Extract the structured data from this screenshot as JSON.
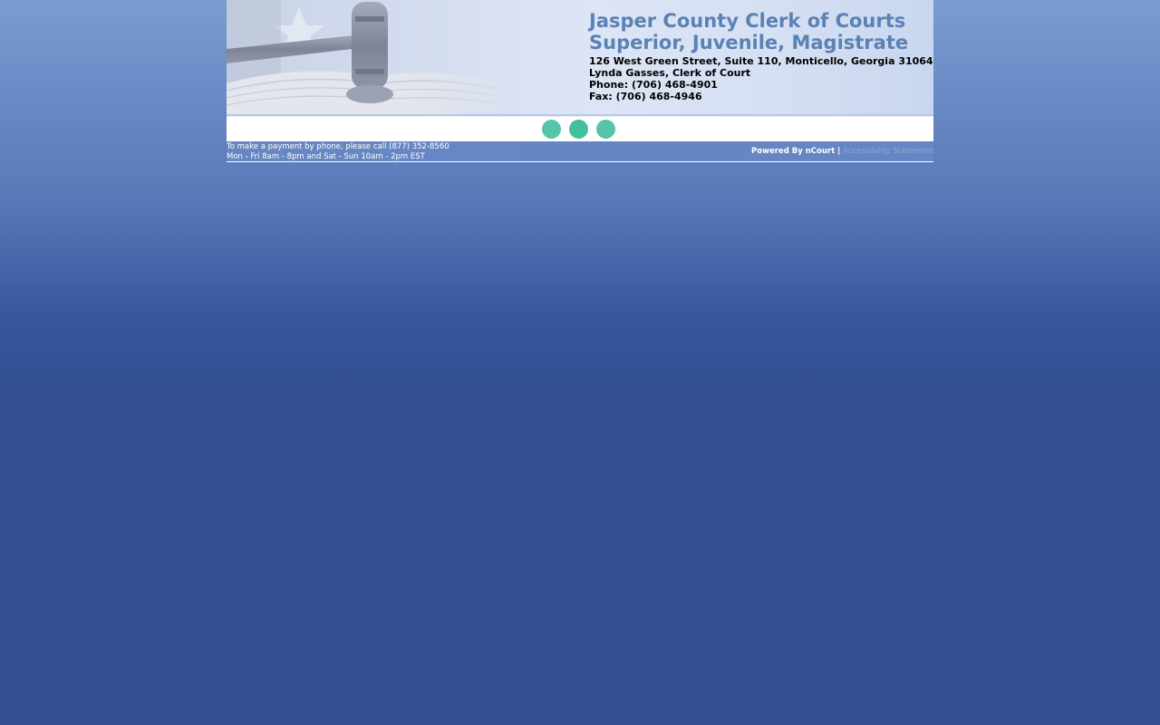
{
  "banner": {
    "title_line1": "Jasper County Clerk of Courts",
    "title_line2": "Superior, Juvenile, Magistrate",
    "address": "126 West Green Street, Suite 110, Monticello, Georgia 31064",
    "clerk": "Lynda Gasses, Clerk of Court",
    "phone": "Phone: (706) 468-4901",
    "fax": "Fax: (706) 468-4946",
    "image": "gavel-and-book-icon"
  },
  "nav": {
    "dots": [
      "nav-dot-1",
      "nav-dot-2",
      "nav-dot-3"
    ],
    "dot_color": "#56c4a9"
  },
  "infobar": {
    "pay_line1": "To make a payment by phone, please call (877) 352-8560",
    "pay_line2": "Mon - Fri 8am - 8pm and Sat - Sun 10am - 2pm EST",
    "powered_by": "Powered By nCourt",
    "separator": "|",
    "accessibility": "Accessibility Statement"
  },
  "colors": {
    "title": "#5a82b4",
    "page_bg_top": "#7b9bd3",
    "page_bg_bottom": "#324f93",
    "infobar_bg": "#6787c3"
  }
}
